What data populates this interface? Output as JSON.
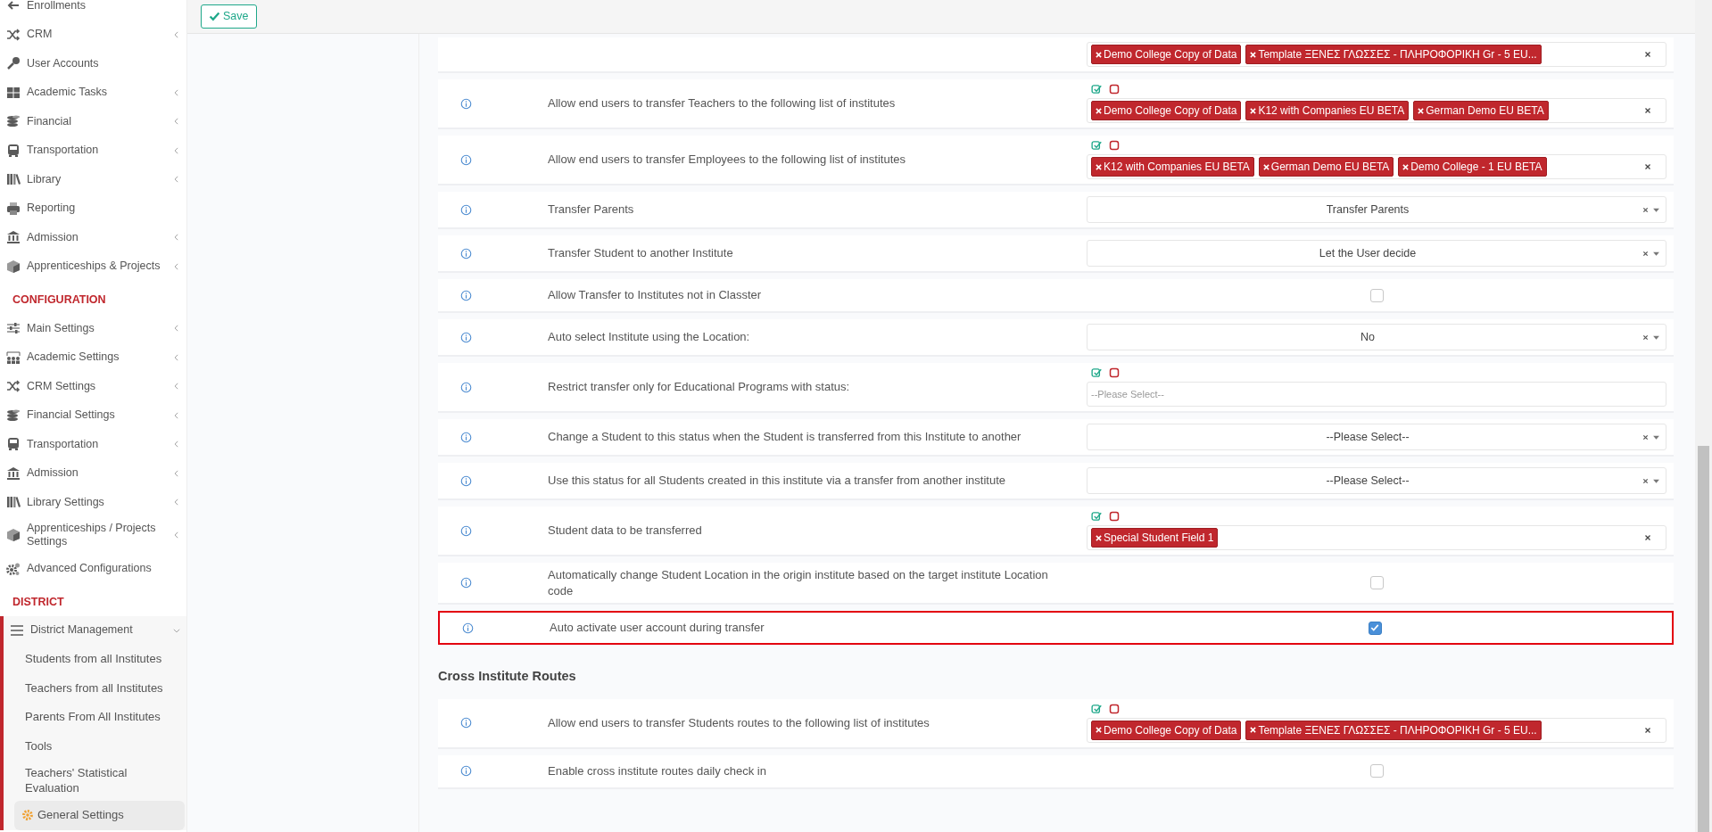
{
  "toolbar": {
    "save_button": "Save"
  },
  "sidebar": {
    "groups": [
      {
        "items": [
          {
            "label": "Enrollments",
            "submenu": false
          },
          {
            "label": "CRM",
            "submenu": true,
            "expanded": false
          },
          {
            "label": "User Accounts",
            "submenu": false
          },
          {
            "label": "Academic Tasks",
            "submenu": true,
            "expanded": false
          },
          {
            "label": "Financial",
            "submenu": true,
            "expanded": false
          },
          {
            "label": "Transportation",
            "submenu": true,
            "expanded": false
          },
          {
            "label": "Library",
            "submenu": true,
            "expanded": false
          },
          {
            "label": "Reporting",
            "submenu": false
          },
          {
            "label": "Admission",
            "submenu": true,
            "expanded": false
          },
          {
            "label": "Apprenticeships & Projects",
            "submenu": true,
            "expanded": false
          }
        ]
      },
      {
        "heading": "CONFIGURATION",
        "items": [
          {
            "label": "Main Settings",
            "submenu": true,
            "expanded": false
          },
          {
            "label": "Academic Settings",
            "submenu": true,
            "expanded": false
          },
          {
            "label": "CRM Settings",
            "submenu": true,
            "expanded": false
          },
          {
            "label": "Financial Settings",
            "submenu": true,
            "expanded": false
          },
          {
            "label": "Transportation",
            "submenu": true,
            "expanded": false
          },
          {
            "label": "Admission",
            "submenu": true,
            "expanded": false
          },
          {
            "label": "Library Settings",
            "submenu": true,
            "expanded": false
          },
          {
            "label": "Apprenticeships / Projects Settings",
            "submenu": true,
            "expanded": false
          },
          {
            "label": "Advanced Configurations",
            "submenu": false
          }
        ]
      },
      {
        "heading": "DISTRICT",
        "items": [
          {
            "label": "District Management",
            "submenu": true,
            "expanded": true,
            "children": [
              {
                "label": "Students from all Institutes",
                "selected": false
              },
              {
                "label": "Teachers from all Institutes",
                "selected": false
              },
              {
                "label": "Parents From All Institutes",
                "selected": false
              },
              {
                "label": "Tools",
                "selected": false
              },
              {
                "label": "Teachers' Statistical Evaluation",
                "selected": false
              },
              {
                "label": "General Settings",
                "selected": true
              }
            ]
          }
        ]
      }
    ]
  },
  "settings": {
    "rows": [
      {
        "kind": "tags",
        "bulk_buttons": false,
        "highlighted": false,
        "tags": [
          "Demo College Copy of Data",
          "Template ΞΕΝΕΣ ΓΛΩΣΣΕΣ - ΠΛΗΡΟΦΟΡΙΚΗ Gr - 5 EU..."
        ]
      },
      {
        "kind": "tags",
        "label": "Allow end users to transfer Teachers to the following list of institutes",
        "bulk_buttons": true,
        "highlighted": false,
        "tags": [
          "Demo College Copy of Data",
          "K12 with Companies EU BETA",
          "German Demo EU BETA"
        ]
      },
      {
        "kind": "tags",
        "label": "Allow end users to transfer Employees to the following list of institutes",
        "bulk_buttons": true,
        "highlighted": false,
        "tags": [
          "K12 with Companies EU BETA",
          "German Demo EU BETA",
          "Demo College - 1 EU BETA"
        ]
      },
      {
        "kind": "select",
        "label": "Transfer Parents",
        "highlighted": false,
        "value": "Transfer Parents"
      },
      {
        "kind": "select",
        "label": "Transfer Student to another Institute",
        "highlighted": false,
        "value": "Let the User decide"
      },
      {
        "kind": "checkbox",
        "label": "Allow Transfer to Institutes not in Classter",
        "highlighted": false,
        "checked": false
      },
      {
        "kind": "select",
        "label": "Auto select Institute using the Location:",
        "highlighted": false,
        "value": "No"
      },
      {
        "kind": "tags",
        "label": "Restrict transfer only for Educational Programs with status:",
        "bulk_buttons": true,
        "highlighted": false,
        "placeholder": "--Please Select--"
      },
      {
        "kind": "select",
        "label": "Change a Student to this status when the Student is transferred from this Institute to another",
        "highlighted": false,
        "value": "--Please Select--"
      },
      {
        "kind": "select",
        "label": "Use this status for all Students created in this institute via a transfer from another institute",
        "highlighted": false,
        "value": "--Please Select--"
      },
      {
        "kind": "tags",
        "label": "Student data to be transferred",
        "bulk_buttons": true,
        "highlighted": false,
        "tags": [
          "Special Student Field 1"
        ]
      },
      {
        "kind": "checkbox",
        "label": "Automatically change Student Location in the origin institute based on the target institute Location code",
        "highlighted": false,
        "checked": false
      },
      {
        "kind": "checkbox",
        "label": "Auto activate user account during transfer",
        "highlighted": true,
        "checked": true
      }
    ]
  },
  "cross_institute_routes": {
    "title": "Cross Institute Routes",
    "rows": [
      {
        "kind": "tags",
        "label": "Allow end users to transfer Students routes to the following list of institutes",
        "bulk_buttons": true,
        "highlighted": false,
        "tags": [
          "Demo College Copy of Data",
          "Template ΞΕΝΕΣ ΓΛΩΣΣΕΣ - ΠΛΗΡΟΦΟΡΙΚΗ Gr - 5 EU..."
        ]
      },
      {
        "kind": "checkbox",
        "label": "Enable cross institute routes daily check in",
        "highlighted": false,
        "checked": false
      }
    ]
  }
}
